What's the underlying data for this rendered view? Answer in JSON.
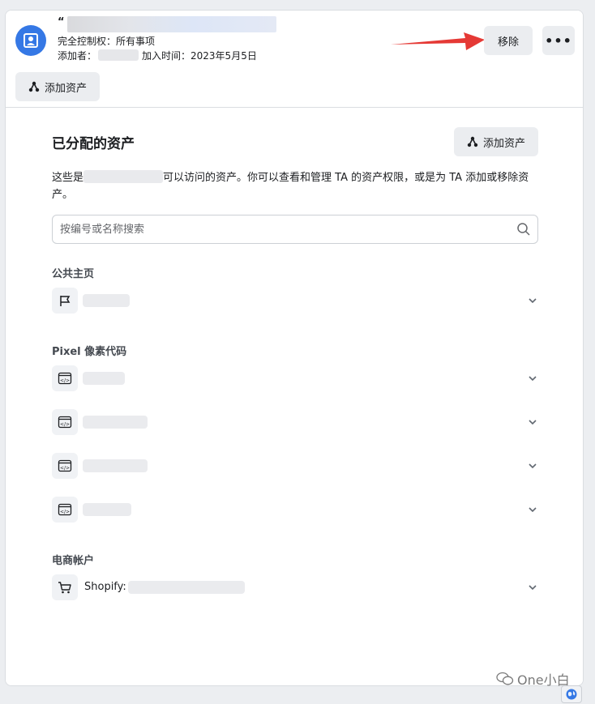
{
  "header": {
    "user_name": "“",
    "control_label": "完全控制权：所有事项",
    "added_by_label": "添加者：",
    "joined_label": "加入时间：2023年5月5日",
    "remove_button": "移除",
    "more_button": "•••",
    "add_asset_button": "添加资产"
  },
  "main": {
    "title": "已分配的资产",
    "add_asset_button": "添加资产",
    "desc_prefix": "这些是",
    "desc_suffix": "可以访问的资产。你可以查看和管理 TA 的资产权限，或是为 TA 添加或移除资产。",
    "search_placeholder": "按编号或名称搜索"
  },
  "groups": {
    "pages_label": "公共主页",
    "pixel_label": "Pixel 像素代码",
    "commerce_label": "电商帐户",
    "shopify_label": "Shopify:"
  },
  "icons": {
    "avatar": "user-badge-icon",
    "share": "share-nodes-icon",
    "flag": "flag-icon",
    "code": "code-window-icon",
    "cart": "cart-icon",
    "chevron": "chevron-down-icon",
    "search": "search-icon"
  },
  "colors": {
    "accent": "#3578e5",
    "arrow": "#e53935"
  },
  "watermark": {
    "text": "One小白"
  }
}
